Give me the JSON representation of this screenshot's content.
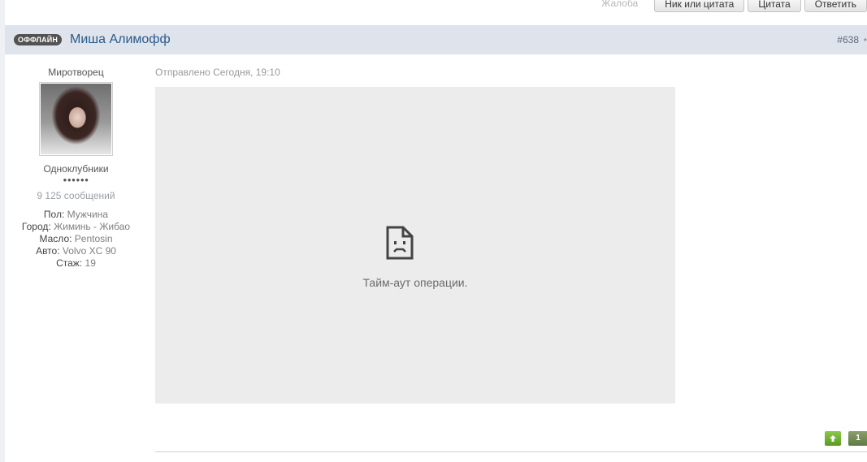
{
  "top_actions": {
    "complaint": "Жалоба",
    "nick_or_quote": "Ник или цитата",
    "quote": "Цитата",
    "reply": "Ответить"
  },
  "post": {
    "status_badge": "ОФФЛАЙН",
    "author": "Миша Алимофф",
    "number": "#638",
    "dot": "•",
    "date": "Отправлено Сегодня, 19:10"
  },
  "user": {
    "title": "Миротворец",
    "group": "Одноклубники",
    "pips": "●●●●●●",
    "post_count": "9  125 сообщений",
    "fields": [
      {
        "label": "Пол:",
        "value": "Мужчина"
      },
      {
        "label": "Город:",
        "value": "Жиминь - Жибао"
      },
      {
        "label": "Масло:",
        "value": "Pentosin"
      },
      {
        "label": "Авто:",
        "value": "Volvo XC 90"
      },
      {
        "label": "Стаж:",
        "value": "19"
      }
    ]
  },
  "embed": {
    "icon": "broken-document-icon",
    "error_text": "Тайм-аут операции."
  },
  "footer": {
    "up_icon": "arrow-up-icon",
    "page": "1"
  }
}
